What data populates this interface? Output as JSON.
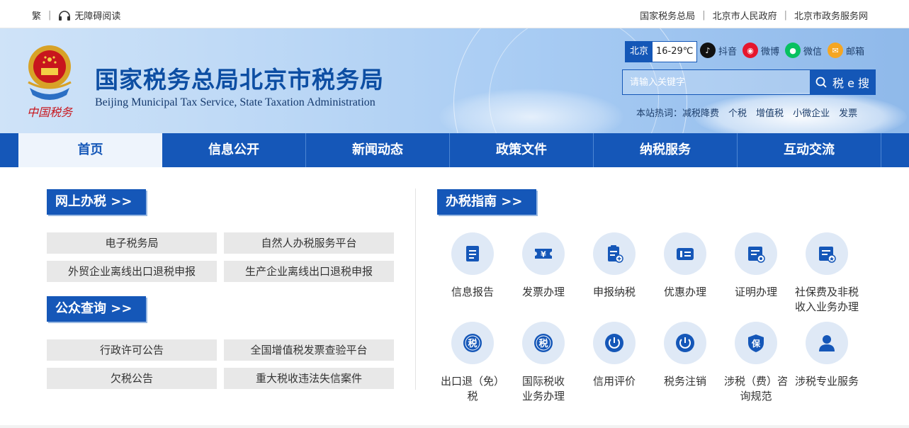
{
  "topbar": {
    "traditional": "繁",
    "accessibility": "无障碍阅读",
    "links": [
      "国家税务总局",
      "北京市人民政府",
      "北京市政务服务网"
    ]
  },
  "header": {
    "title": "国家税务总局北京市税务局",
    "subtitle": "Beijing Municipal Tax Service, State Taxation Administration",
    "emblem_text": "中国税务",
    "weather": {
      "city": "北京",
      "temp": "16-29℃"
    },
    "social": [
      {
        "label": "抖音",
        "icon": "douyin-icon",
        "color": "#111111"
      },
      {
        "label": "微博",
        "icon": "weibo-icon",
        "color": "#e6162d"
      },
      {
        "label": "微信",
        "icon": "wechat-icon",
        "color": "#07c160"
      },
      {
        "label": "邮箱",
        "icon": "mail-icon",
        "color": "#f5a623"
      }
    ],
    "search": {
      "placeholder": "请输入关键字",
      "button": "税 e 搜"
    },
    "hot": {
      "prefix": "本站热词：",
      "items": [
        "减税降费",
        "个税",
        "增值税",
        "小微企业",
        "发票"
      ]
    }
  },
  "nav": {
    "tabs": [
      "首页",
      "信息公开",
      "新闻动态",
      "政策文件",
      "纳税服务",
      "互动交流"
    ],
    "active": 0
  },
  "online": {
    "title": "网上办税 >>",
    "links": [
      "电子税务局",
      "自然人办税服务平台",
      "外贸企业离线出口退税申报",
      "生产企业离线出口退税申报"
    ]
  },
  "query": {
    "title": "公众查询 >>",
    "links": [
      "行政许可公告",
      "全国增值税发票查验平台",
      "欠税公告",
      "重大税收违法失信案件"
    ]
  },
  "guide": {
    "title": "办税指南 >>",
    "services": [
      {
        "label": "信息报告",
        "icon": "document-icon"
      },
      {
        "label": "发票办理",
        "icon": "invoice-ticket-icon"
      },
      {
        "label": "申报纳税",
        "icon": "declare-clipboard-icon"
      },
      {
        "label": "优惠办理",
        "icon": "discount-card-icon"
      },
      {
        "label": "证明办理",
        "icon": "certificate-icon"
      },
      {
        "label": "社保费及非税收入业务办理",
        "icon": "social-security-icon"
      },
      {
        "label": "出口退（免）税",
        "icon": "export-tax-icon"
      },
      {
        "label": "国际税收业务办理",
        "icon": "international-tax-icon"
      },
      {
        "label": "信用评价",
        "icon": "credit-power-icon"
      },
      {
        "label": "税务注销",
        "icon": "deregister-power-icon"
      },
      {
        "label": "涉税（费）咨询规范",
        "icon": "shield-bao-icon"
      },
      {
        "label": "涉税专业服务",
        "icon": "person-icon"
      }
    ],
    "glyph_tax": "税",
    "glyph_bao": "保",
    "glyph_yen": "¥"
  },
  "colors": {
    "brand": "#1557b8",
    "title": "#0d4ea3",
    "icon_bg": "#dfe9f6"
  }
}
